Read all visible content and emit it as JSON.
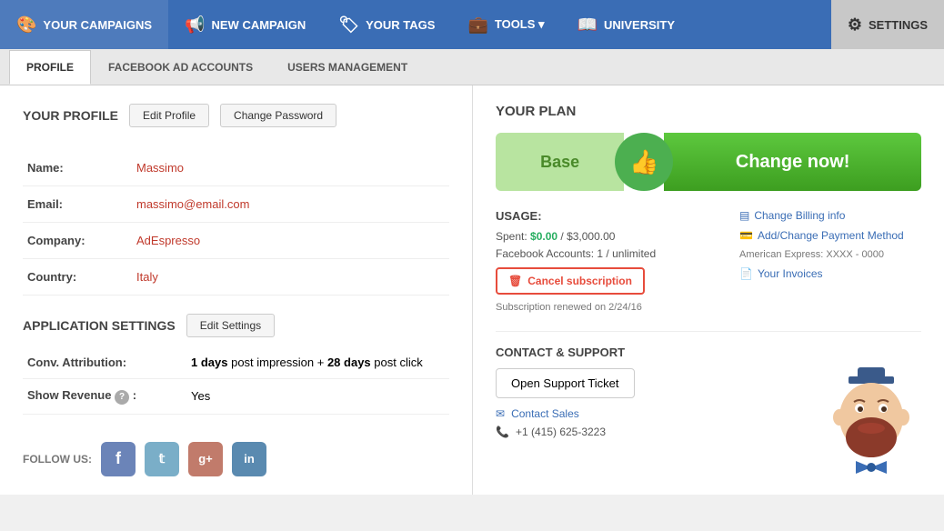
{
  "topNav": {
    "items": [
      {
        "id": "campaigns",
        "label": "YOUR CAMPAIGNS",
        "icon": "🎨"
      },
      {
        "id": "new-campaign",
        "label": "NEW CAMPAIGN",
        "icon": "📢"
      },
      {
        "id": "your-tags",
        "label": "YOUR TAGS",
        "icon": "🏷"
      },
      {
        "id": "tools",
        "label": "TOOLS ▾",
        "icon": "💼"
      },
      {
        "id": "university",
        "label": "UNIVERSITY",
        "icon": "📖"
      },
      {
        "id": "settings",
        "label": "SETTINGS",
        "icon": "⚙"
      }
    ]
  },
  "subNav": {
    "tabs": [
      {
        "id": "profile",
        "label": "PROFILE",
        "active": true
      },
      {
        "id": "facebook-ad-accounts",
        "label": "FACEBOOK AD ACCOUNTS",
        "active": false
      },
      {
        "id": "users-management",
        "label": "USERS MANAGEMENT",
        "active": false
      }
    ]
  },
  "profile": {
    "sectionTitle": "YOUR PROFILE",
    "editButton": "Edit Profile",
    "changePasswordButton": "Change Password",
    "fields": [
      {
        "label": "Name:",
        "value": "Massimo"
      },
      {
        "label": "Email:",
        "value": "massimo@email.com"
      },
      {
        "label": "Company:",
        "value": "AdEspresso"
      },
      {
        "label": "Country:",
        "value": "Italy"
      }
    ]
  },
  "appSettings": {
    "sectionTitle": "APPLICATION SETTINGS",
    "editButton": "Edit Settings",
    "fields": [
      {
        "label": "Conv. Attribution:",
        "value": "1 days post impression + 28 days post click"
      },
      {
        "label": "Show Revenue",
        "hasHelp": true,
        "value": "Yes"
      }
    ]
  },
  "followUs": {
    "label": "FOLLOW US:",
    "networks": [
      {
        "id": "facebook",
        "icon": "f",
        "color": "#6b84b8"
      },
      {
        "id": "twitter",
        "icon": "𝕥",
        "color": "#7aaec8"
      },
      {
        "id": "google-plus",
        "icon": "g+",
        "color": "#c17b6b"
      },
      {
        "id": "linkedin",
        "icon": "in",
        "color": "#5a8ab0"
      }
    ]
  },
  "plan": {
    "sectionTitle": "YOUR PLAN",
    "baseName": "Base",
    "changeButton": "Change now!",
    "thumbIcon": "👍"
  },
  "usage": {
    "title": "USAGE:",
    "spent": "$0.00",
    "spentTotal": "$3,000.00",
    "facebookAccountsCount": "1",
    "facebookAccountsTotal": "unlimited",
    "cancelButton": "Cancel subscription",
    "renewText": "Subscription renewed on 2/24/16"
  },
  "billing": {
    "changeInfoLabel": "Change Billing info",
    "paymentLabel": "Add/Change Payment Method",
    "cardInfo": "American Express: XXXX - 0000",
    "invoicesLabel": "Your Invoices"
  },
  "contact": {
    "title": "CONTACT & SUPPORT",
    "supportButton": "Open Support Ticket",
    "salesLabel": "Contact Sales",
    "phone": "+1 (415) 625-3223"
  }
}
